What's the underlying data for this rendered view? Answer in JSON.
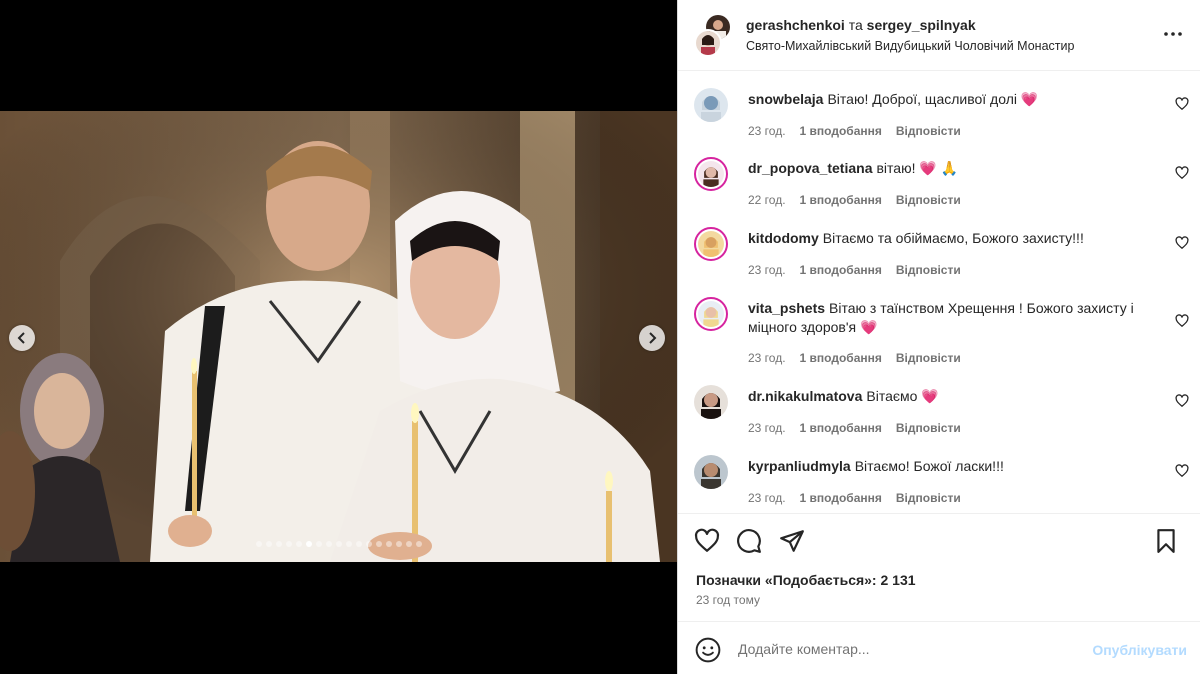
{
  "header": {
    "user_primary": "gerashchenkoi",
    "connector": "та",
    "user_secondary": "sergey_spilnyak",
    "location": "Свято-Михайлівський Видубицький Чоловічий Монастир",
    "more_icon": "more-horizontal-icon"
  },
  "carousel": {
    "dot_count": 17,
    "active_index": 5
  },
  "comments": [
    {
      "username": "snowbelaja",
      "text": "Вітаю! Доброї, щасливої долі",
      "emoji": "💗",
      "time": "23 год.",
      "likes": "1 вподобання",
      "reply": "Відповісти"
    },
    {
      "username": "dr_popova_tetiana",
      "text": "вітаю!",
      "emoji": "💗 🙏",
      "time": "22 год.",
      "likes": "1 вподобання",
      "reply": "Відповісти"
    },
    {
      "username": "kitdodomy",
      "text": "Вітаємо та обіймаємо, Божого захисту!!!",
      "emoji": "",
      "time": "23 год.",
      "likes": "1 вподобання",
      "reply": "Відповісти"
    },
    {
      "username": "vita_pshets",
      "text": "Вітаю з таїнством Хрещення ! Божого захисту і міцного здоров'я",
      "emoji": "💗",
      "time": "23 год.",
      "likes": "1 вподобання",
      "reply": "Відповісти"
    },
    {
      "username": "dr.nikakulmatova",
      "text": "Вітаємо",
      "emoji": "💗",
      "time": "23 год.",
      "likes": "1 вподобання",
      "reply": "Відповісти"
    },
    {
      "username": "kyrpanliudmyla",
      "text": "Вітаємо! Божої ласки!!!",
      "emoji": "",
      "time": "23 год.",
      "likes": "1 вподобання",
      "reply": "Відповісти"
    }
  ],
  "footer": {
    "likes_text": "Позначки «Подобається»: 2 131",
    "time_ago": "23 год тому",
    "comment_placeholder": "Додайте коментар...",
    "publish_label": "Опублікувати"
  },
  "colors": {
    "accent_blue_disabled": "#b3dbff",
    "heart": "#e0245e",
    "story_ring": "#d6249f"
  }
}
